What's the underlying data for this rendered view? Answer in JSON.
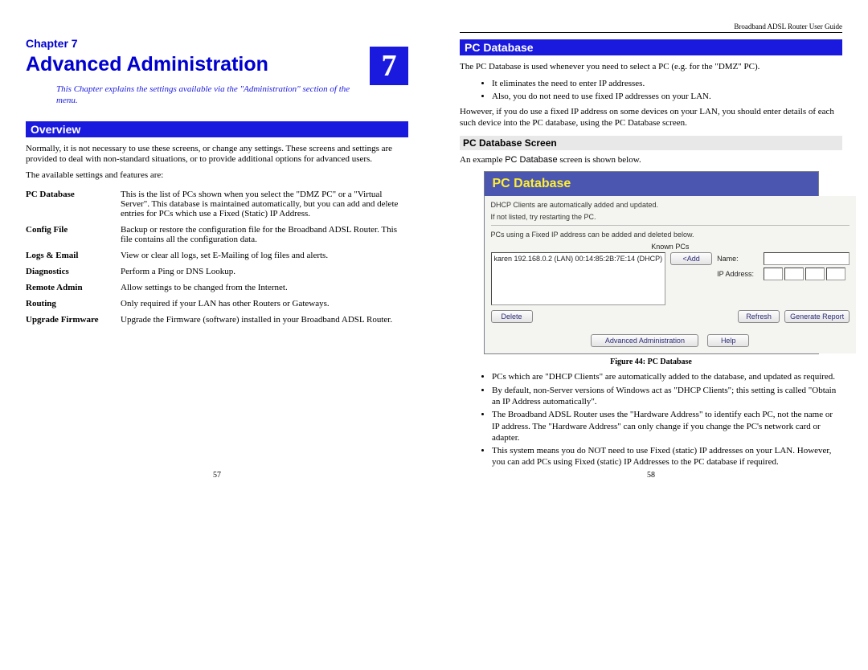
{
  "running_header": "Broadband ADSL Router User Guide",
  "chapter": {
    "label": "Chapter 7",
    "title": "Advanced Administration",
    "badge_number": "7",
    "abstract": "This Chapter explains the settings available via the \"Administration\" section of the menu."
  },
  "overview": {
    "heading": "Overview",
    "intro": "Normally, it is not necessary to use these screens, or change any settings. These screens and settings are provided to deal with non-standard situations, or to provide additional options for advanced users.",
    "avail_line": "The available settings and features are:",
    "features": [
      {
        "name": "PC Database",
        "desc": "This is the list of PCs shown when you select the \"DMZ PC\" or a \"Virtual Server\". This database is maintained automatically, but you can add and delete entries for PCs which use a Fixed (Static) IP Address."
      },
      {
        "name": "Config File",
        "desc": "Backup or restore the configuration file for the Broadband ADSL Router. This file contains all the configuration data."
      },
      {
        "name": "Logs & Email",
        "desc": "View or clear all logs, set E-Mailing of log files and alerts."
      },
      {
        "name": "Diagnostics",
        "desc": "Perform a Ping or DNS Lookup."
      },
      {
        "name": "Remote Admin",
        "desc": "Allow settings to be changed from the Internet."
      },
      {
        "name": "Routing",
        "desc": "Only required if your LAN has other Routers or Gateways."
      },
      {
        "name": "Upgrade Firmware",
        "desc": "Upgrade the Firmware (software) installed in your Broadband ADSL Router."
      }
    ]
  },
  "pcdb": {
    "heading": "PC Database",
    "p1": "The PC Database is used whenever you need to select a PC (e.g. for the \"DMZ\" PC).",
    "b1": "It eliminates the need to enter IP addresses.",
    "b2": "Also, you do not need to use fixed IP addresses on your LAN.",
    "p2": "However, if you do use a fixed IP address on some devices on your LAN, you should enter details of each such device into the PC database, using the PC Database screen.",
    "subhead": "PC Database Screen",
    "example_line_a": "An example ",
    "example_line_b": "PC Database",
    "example_line_c": " screen is shown below.",
    "figure_caption": "Figure 44: PC Database",
    "notes": [
      "PCs which are \"DHCP Clients\" are automatically added to the database, and updated as required.",
      "By default, non-Server versions of Windows act as \"DHCP Clients\"; this setting is called \"Obtain an IP Address automatically\".",
      "The Broadband ADSL Router uses the \"Hardware Address\" to identify each PC, not the name or IP address. The \"Hardware Address\" can only change if you change the PC's network card or adapter.",
      "This system means you do NOT need to use Fixed (static) IP addresses on your LAN. However, you can add PCs using Fixed (static) IP Addresses to the PC database if required."
    ]
  },
  "ui": {
    "title": "PC Database",
    "note1": "DHCP Clients are automatically added and updated.",
    "note2": "If not listed, try restarting the PC.",
    "note3": "PCs using a Fixed IP address can be added and deleted below.",
    "known_label": "Known PCs",
    "list_entry": "karen 192.168.0.2 (LAN) 00:14:85:2B:7E:14 (DHCP)",
    "add_btn": "<Add",
    "name_label": "Name:",
    "ip_label": "IP Address:",
    "delete_btn": "Delete",
    "refresh_btn": "Refresh",
    "report_btn": "Generate Report",
    "adv_btn": "Advanced Administration",
    "help_btn": "Help"
  },
  "page_numbers": {
    "left": "57",
    "right": "58"
  }
}
